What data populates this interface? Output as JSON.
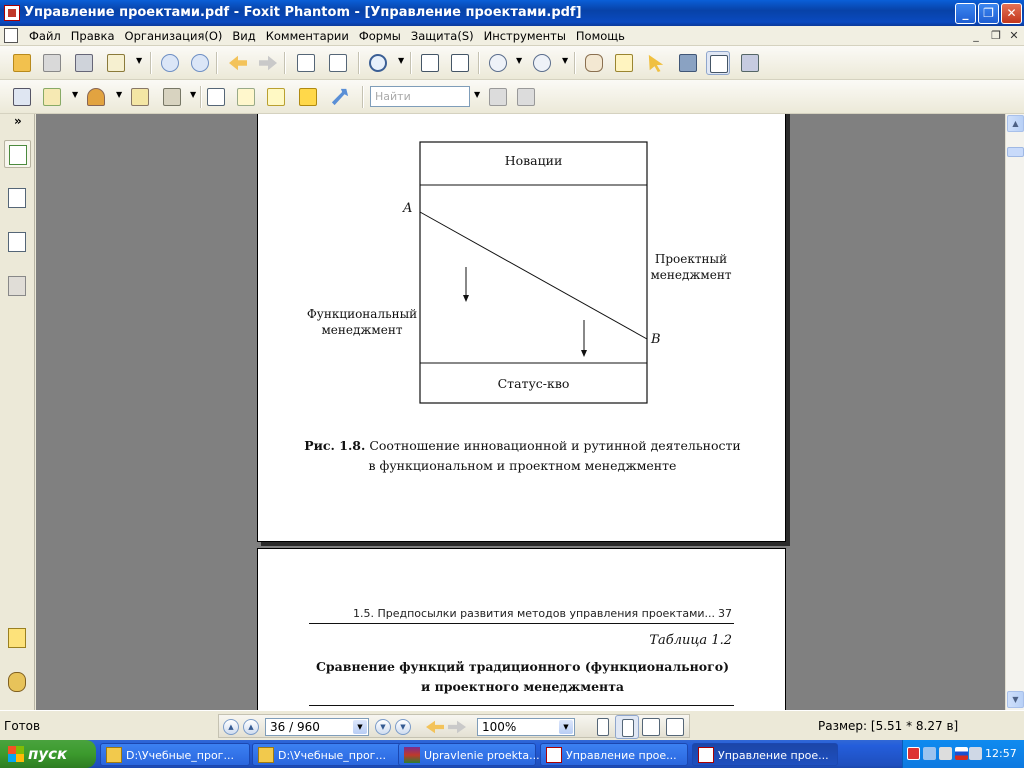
{
  "window": {
    "title": "Управление проектами.pdf - Foxit Phantom - [Управление проектами.pdf]",
    "minimize": "_",
    "restore": "❐",
    "close": "✕"
  },
  "menu": {
    "items": [
      "Файл",
      "Правка",
      "Организация(О)",
      "Вид",
      "Комментарии",
      "Формы",
      "Защита(S)",
      "Инструменты",
      "Помощь"
    ]
  },
  "toolbar": {
    "find_placeholder": "Найти"
  },
  "document": {
    "figure": {
      "box_top_label": "Новации",
      "box_bottom_label": "Статус-кво",
      "point_a": "A",
      "point_b": "B",
      "left_label_line1": "Функциональный",
      "left_label_line2": "менеджмент",
      "right_label_line1": "Проектный",
      "right_label_line2": "менеджмент",
      "caption_bold": "Рис. 1.8.",
      "caption_line1": "Соотношение инновационной и рутинной деятельности",
      "caption_line2": "в функциональном и проектном менеджменте"
    },
    "page2": {
      "running_header": "1.5. Предпосылки развития методов управления проектами...",
      "page_number": "37",
      "table_label": "Таблица 1.2",
      "table_title_line1": "Сравнение функций традиционного (функционального)",
      "table_title_line2": "и проектного менеджмента"
    }
  },
  "status": {
    "ready": "Готов",
    "page": "36 / 960",
    "zoom": "100%",
    "size": "Размер: [5.51 * 8.27 в]"
  },
  "taskbar": {
    "start": "пуск",
    "tasks": [
      "D:\\Учебные_прог...",
      "D:\\Учебные_прог...",
      "Upravlenie proekta...",
      "Управление прое...",
      "Управление прое..."
    ],
    "clock": "12:57"
  }
}
